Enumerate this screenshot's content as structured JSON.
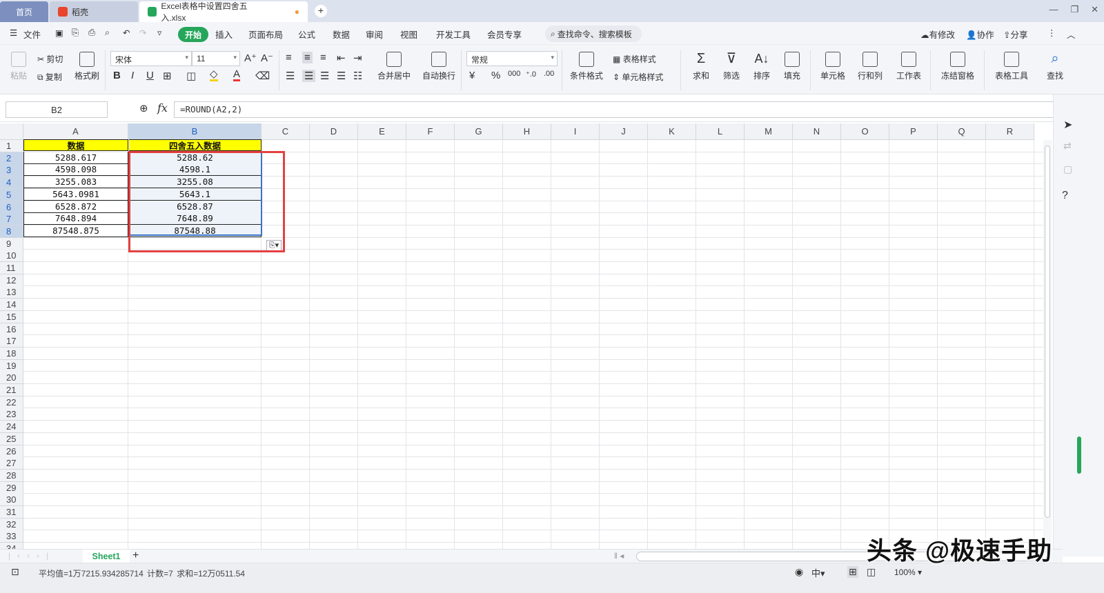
{
  "tabs": {
    "home": "首页",
    "wps": "稻壳",
    "file": "Excel表格中设置四舍五入.xlsx"
  },
  "menu": {
    "file": "文件",
    "start": "开始",
    "items": [
      "插入",
      "页面布局",
      "公式",
      "数据",
      "审阅",
      "视图",
      "开发工具",
      "会员专享"
    ],
    "search": "查找命令、搜索模板",
    "right": [
      "有修改",
      "协作",
      "分享"
    ]
  },
  "ribbon": {
    "paste": "粘贴",
    "cut": "剪切",
    "copy": "复制",
    "format_painter": "格式刷",
    "font_name": "宋体",
    "font_size": "11",
    "number_format": "常规",
    "merge": "合并居中",
    "wrap": "自动换行",
    "cond_format": "条件格式",
    "table_style": "表格样式",
    "cell_style": "单元格样式",
    "sum": "求和",
    "filter": "筛选",
    "sort": "排序",
    "fill": "填充",
    "cell": "单元格",
    "rowcol": "行和列",
    "worksheet": "工作表",
    "freeze": "冻结窗格",
    "table_tools": "表格工具",
    "find": "查找"
  },
  "formula_bar": {
    "name_box": "B2",
    "fx": "fx",
    "formula": "=ROUND(A2,2)"
  },
  "grid": {
    "columns": [
      "A",
      "B",
      "C",
      "D",
      "E",
      "F",
      "G",
      "H",
      "I",
      "J",
      "K",
      "L",
      "M",
      "N",
      "O",
      "P",
      "Q",
      "R"
    ],
    "header_row": {
      "a": "数据",
      "b": "四舍五入数据"
    },
    "rows": [
      {
        "a": "5288.617",
        "b": "5288.62"
      },
      {
        "a": "4598.098",
        "b": "4598.1"
      },
      {
        "a": "3255.083",
        "b": "3255.08"
      },
      {
        "a": "5643.0981",
        "b": "5643.1"
      },
      {
        "a": "6528.872",
        "b": "6528.87"
      },
      {
        "a": "7648.894",
        "b": "7648.89"
      },
      {
        "a": "87548.875",
        "b": "87548.88"
      }
    ]
  },
  "sheet": {
    "name": "Sheet1",
    "add": "+"
  },
  "status": {
    "stats": "平均值=1万7215.934285714  计数=7  求和=12万0511.54",
    "zoom": "100%"
  },
  "watermark": "头条 @极速手助"
}
